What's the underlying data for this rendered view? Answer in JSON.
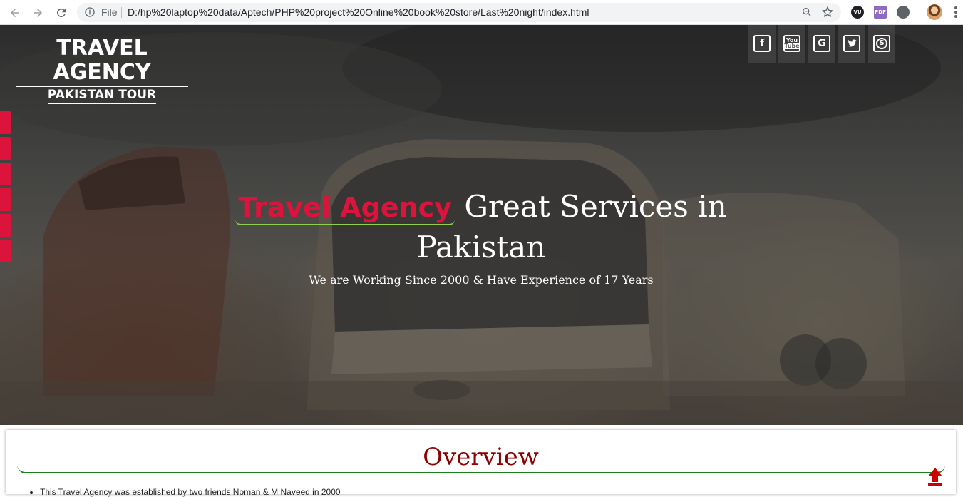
{
  "browser": {
    "file_label": "File",
    "url": "D:/hp%20laptop%20data/Aptech/PHP%20project%20Online%20book%20store/Last%20night/index.html",
    "extensions": [
      {
        "icon": "vu-extension-icon",
        "label": "VU",
        "color": "#202124"
      },
      {
        "icon": "pdf-extension-icon",
        "label": "PDF",
        "color": "#8e6bbf"
      },
      {
        "icon": "circle-extension-icon",
        "label": "",
        "color": "#5f6368"
      }
    ]
  },
  "hero": {
    "logo_title": "TRAVEL AGENCY",
    "logo_subtitle": "PAKISTAN TOUR",
    "heading_brand": "Travel Agency",
    "heading_rest": "Great Services in Pakistan",
    "subtitle": "We are Working Since 2000 & Have Experience of 17 Years",
    "social": [
      {
        "name": "facebook-icon",
        "glyph": "f"
      },
      {
        "name": "youtube-icon",
        "glyph": "You"
      },
      {
        "name": "google-icon",
        "glyph": "G"
      },
      {
        "name": "twitter-icon",
        "glyph": "t"
      },
      {
        "name": "skype-icon",
        "glyph": "S"
      }
    ],
    "side_tab_count": 6,
    "colors": {
      "accent": "#dc143c",
      "underline": "#8fd14f"
    }
  },
  "overview": {
    "title": "Overview",
    "items": [
      "This Travel Agency was established by two friends Noman & M Naveed in 2000"
    ],
    "colors": {
      "title": "#8b0000",
      "line": "#1a7f1a",
      "scroll_top": "#cc0000"
    }
  }
}
